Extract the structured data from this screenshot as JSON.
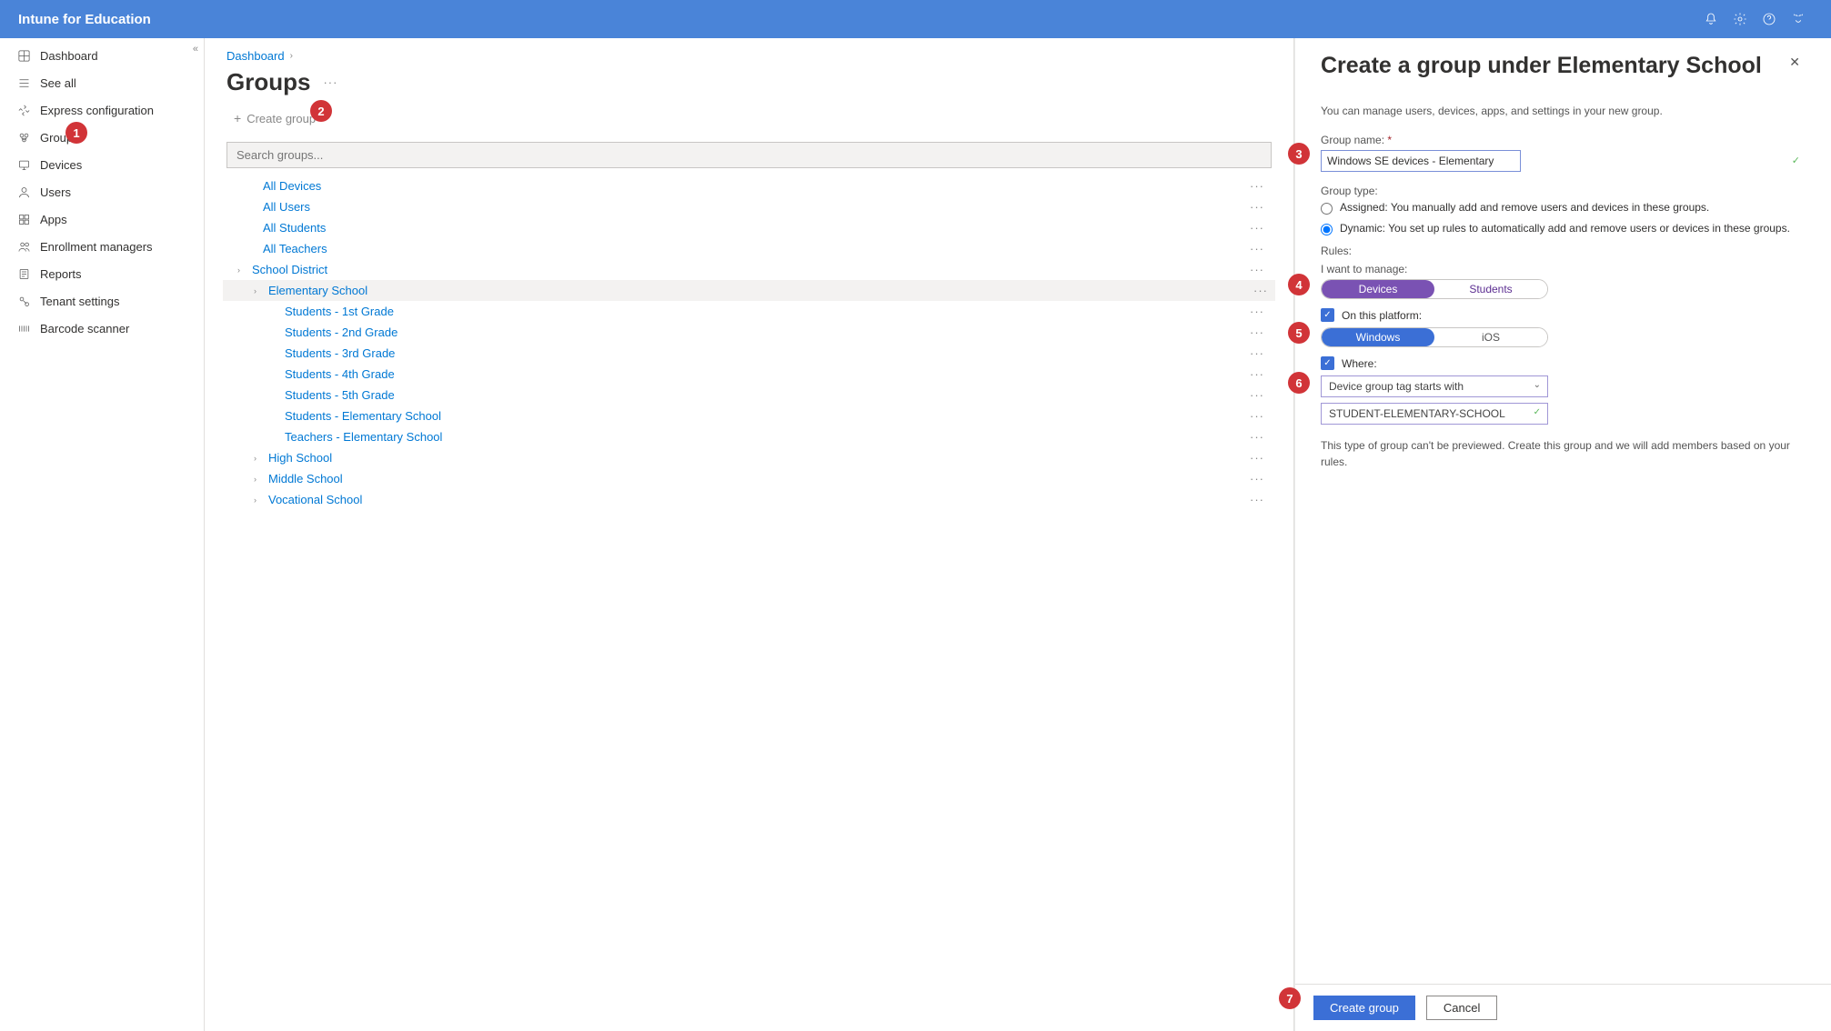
{
  "header": {
    "title": "Intune for Education"
  },
  "sidebar": {
    "items": [
      {
        "label": "Dashboard"
      },
      {
        "label": "See all"
      },
      {
        "label": "Express configuration"
      },
      {
        "label": "Groups"
      },
      {
        "label": "Devices"
      },
      {
        "label": "Users"
      },
      {
        "label": "Apps"
      },
      {
        "label": "Enrollment managers"
      },
      {
        "label": "Reports"
      },
      {
        "label": "Tenant settings"
      },
      {
        "label": "Barcode scanner"
      }
    ]
  },
  "breadcrumb": {
    "item": "Dashboard"
  },
  "page": {
    "title": "Groups",
    "create_label": "Create group"
  },
  "search": {
    "placeholder": "Search groups..."
  },
  "tree": {
    "root": [
      {
        "label": "All Devices",
        "indent": 24
      },
      {
        "label": "All Users",
        "indent": 24
      },
      {
        "label": "All Students",
        "indent": 24
      },
      {
        "label": "All Teachers",
        "indent": 24
      },
      {
        "label": "School District",
        "indent": 12,
        "chevron": true
      },
      {
        "label": "Elementary School",
        "indent": 30,
        "chevron": true,
        "selected": true
      },
      {
        "label": "Students - 1st Grade",
        "indent": 48
      },
      {
        "label": "Students - 2nd Grade",
        "indent": 48
      },
      {
        "label": "Students - 3rd Grade",
        "indent": 48
      },
      {
        "label": "Students - 4th Grade",
        "indent": 48
      },
      {
        "label": "Students - 5th Grade",
        "indent": 48
      },
      {
        "label": "Students - Elementary School",
        "indent": 48
      },
      {
        "label": "Teachers - Elementary School",
        "indent": 48
      },
      {
        "label": "High School",
        "indent": 30,
        "chevron": true
      },
      {
        "label": "Middle School",
        "indent": 30,
        "chevron": true
      },
      {
        "label": "Vocational School",
        "indent": 30,
        "chevron": true
      }
    ]
  },
  "panel": {
    "title": "Create a group under Elementary School",
    "desc": "You can manage users, devices, apps, and settings in your new group.",
    "group_name_label": "Group name:",
    "group_name_value": "Windows SE devices - Elementary",
    "group_type_label": "Group type:",
    "assigned_label": "Assigned: You manually add and remove users and devices in these groups.",
    "dynamic_label": "Dynamic: You set up rules to automatically add and remove users or devices in these groups.",
    "rules_label": "Rules:",
    "manage_label": "I want to manage:",
    "pill1a": "Devices",
    "pill1b": "Students",
    "platform_label": "On this platform:",
    "pill2a": "Windows",
    "pill2b": "iOS",
    "where_label": "Where:",
    "select_value": "Device group tag starts with",
    "tag_value": "STUDENT-ELEMENTARY-SCHOOL",
    "note": "This type of group can't be previewed. Create this group and we will add members based on your rules.",
    "create_btn": "Create group",
    "cancel_btn": "Cancel"
  },
  "callouts": [
    "1",
    "2",
    "3",
    "4",
    "5",
    "6",
    "7"
  ]
}
